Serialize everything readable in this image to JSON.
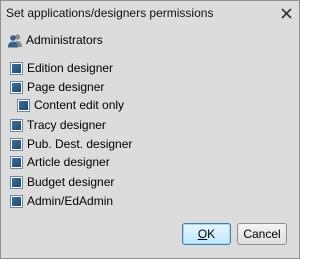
{
  "window": {
    "title": "Set applications/designers permissions",
    "close_icon": "close-icon"
  },
  "group": {
    "icon": "users-icon",
    "label": "Administrators"
  },
  "permissions": [
    {
      "label": "Edition designer",
      "checked": true
    },
    {
      "label": "Page designer",
      "checked": true
    },
    {
      "label": "Content edit only",
      "checked": true
    },
    {
      "label": "Tracy designer",
      "checked": true
    },
    {
      "label": "Pub. Dest. designer",
      "checked": true
    },
    {
      "label": "Article designer",
      "checked": true
    },
    {
      "label": "Budget designer",
      "checked": true
    },
    {
      "label": "Admin/EdAdmin",
      "checked": true
    }
  ],
  "buttons": {
    "ok_label_first": "O",
    "ok_label_rest": "K",
    "cancel_label": "Cancel"
  },
  "colors": {
    "dialog_bg": "#dcdcdc",
    "checkbox_fill": "#2a5a86"
  }
}
